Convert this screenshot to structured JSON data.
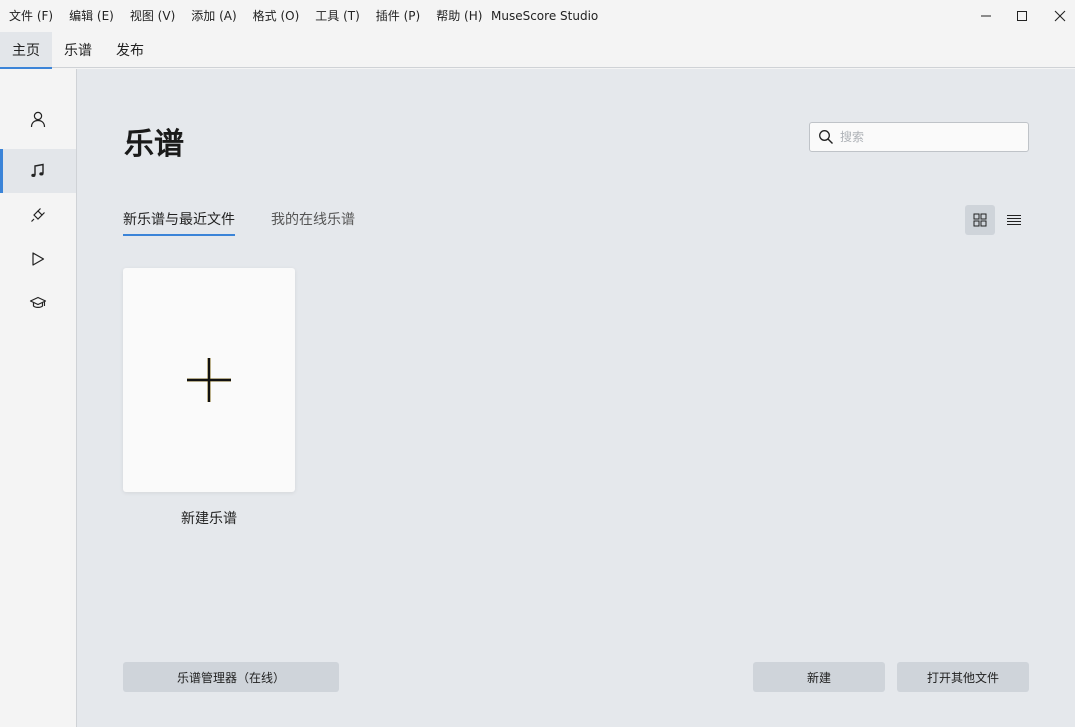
{
  "menu": [
    "文件 (F)",
    "编辑 (E)",
    "视图 (V)",
    "添加 (A)",
    "格式 (O)",
    "工具 (T)",
    "插件 (P)",
    "帮助 (H)"
  ],
  "app_title": "MuseScore Studio",
  "window_controls": [
    "minimize-icon",
    "maximize-icon",
    "close-icon"
  ],
  "top_tabs": [
    {
      "label": "主页",
      "active": true
    },
    {
      "label": "乐谱",
      "active": false
    },
    {
      "label": "发布",
      "active": false
    }
  ],
  "sidebar": [
    {
      "icon": "account-icon",
      "active": false
    },
    {
      "icon": "music-note-icon",
      "active": true
    },
    {
      "icon": "plugins-icon",
      "active": false
    },
    {
      "icon": "play-icon",
      "active": false
    },
    {
      "icon": "learn-icon",
      "active": false
    }
  ],
  "main": {
    "title": "乐谱",
    "search_placeholder": "搜索",
    "subtabs": [
      {
        "label": "新乐谱与最近文件",
        "active": true
      },
      {
        "label": "我的在线乐谱",
        "active": false
      }
    ],
    "view_modes": [
      {
        "icon": "grid-view-icon",
        "active": true
      },
      {
        "icon": "list-view-icon",
        "active": false
      }
    ],
    "new_score_label": "新建乐谱",
    "buttons": {
      "score_manager": "乐谱管理器（在线）",
      "new": "新建",
      "open_other": "打开其他文件"
    }
  },
  "colors": {
    "accent": "#3b84d8",
    "background": "#e5e8ec",
    "panel": "#f4f4f4"
  }
}
